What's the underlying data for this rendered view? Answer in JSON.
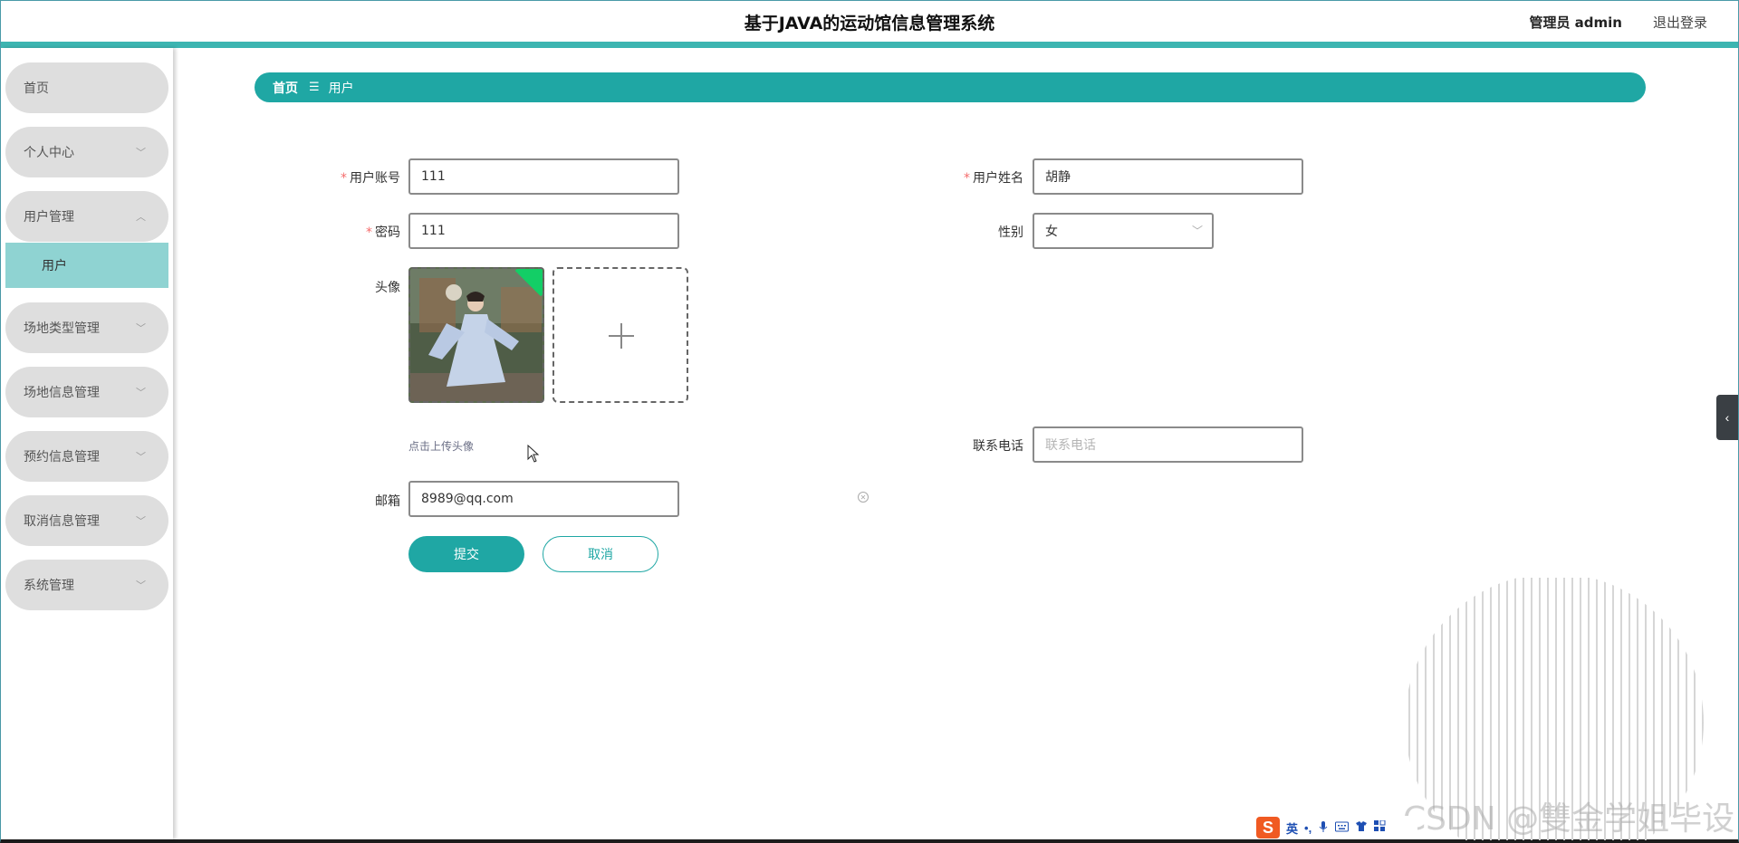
{
  "header": {
    "title": "基于JAVA的运动馆信息管理系统",
    "admin_label": "管理员 admin",
    "logout_label": "退出登录"
  },
  "sidebar": {
    "items": [
      {
        "label": "首页",
        "has_chevron": false
      },
      {
        "label": "个人中心",
        "has_chevron": true
      },
      {
        "label": "用户管理",
        "has_chevron": true,
        "expanded": true
      },
      {
        "label": "场地类型管理",
        "has_chevron": true
      },
      {
        "label": "场地信息管理",
        "has_chevron": true
      },
      {
        "label": "预约信息管理",
        "has_chevron": true
      },
      {
        "label": "取消信息管理",
        "has_chevron": true
      },
      {
        "label": "系统管理",
        "has_chevron": true
      }
    ],
    "active_sub": "用户"
  },
  "breadcrumb": {
    "home": "首页",
    "separator": "☰",
    "current": "用户"
  },
  "form": {
    "account_label": "用户账号",
    "account_value": "111",
    "name_label": "用户姓名",
    "name_value": "胡静",
    "password_label": "密码",
    "password_value": "111",
    "gender_label": "性别",
    "gender_value": "女",
    "avatar_label": "头像",
    "avatar_hint": "点击上传头像",
    "phone_label": "联系电话",
    "phone_placeholder": "联系电话",
    "email_label": "邮箱",
    "email_value": "8989@qq.com",
    "required_mark": "*"
  },
  "actions": {
    "submit_label": "提交",
    "cancel_label": "取消"
  },
  "watermark": "CSDN @雙金学姐毕设",
  "ime": {
    "logo": "S",
    "lang": "英",
    "punct": "•,"
  },
  "colors": {
    "accent": "#1fa7a4",
    "topline": "#3cb5b1",
    "active_sub_bg": "#8fd3d2",
    "menu_bg": "#dedede",
    "required": "#f56c6c",
    "upload_success_corner": "#13ce66"
  }
}
